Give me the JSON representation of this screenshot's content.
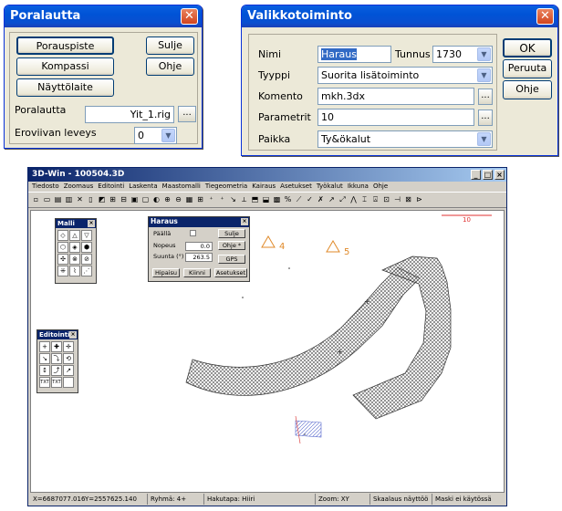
{
  "poralautta": {
    "title": "Poralautta",
    "buttons": {
      "porauspiste": "Porauspiste",
      "kompassi": "Kompassi",
      "naytto": "Näyttölaite",
      "sulje": "Sulje",
      "ohje": "Ohje"
    },
    "rig_label": "Poralautta",
    "rig_value": "Yit_1.rig",
    "browse": "...",
    "width_label": "Eroviivan leveys",
    "width_value": "0"
  },
  "valikko": {
    "title": "Valikkotoiminto",
    "nimi_label": "Nimi",
    "nimi_value": "Haraus",
    "tunnus_label": "Tunnus",
    "tunnus_value": "1730",
    "tyyppi_label": "Tyyppi",
    "tyyppi_value": "Suorita lisätoiminto",
    "komento_label": "Komento",
    "komento_value": "mkh.3dx",
    "parametrit_label": "Parametrit",
    "parametrit_value": "10",
    "paikka_label": "Paikka",
    "paikka_value": "Ty&ökalut",
    "browse": "...",
    "buttons": {
      "ok": "OK",
      "peruuta": "Peruuta",
      "ohje": "Ohje"
    }
  },
  "main": {
    "title": "3D-Win - 100504.3D",
    "controls": {
      "minimize": "_",
      "maximize": "□",
      "close": "×"
    },
    "menu": [
      "Tiedosto",
      "Zoomaus",
      "Editointi",
      "Laskenta",
      "Maastomalli",
      "Tiegeometria",
      "Kairaus",
      "Asetukset",
      "Työkalut",
      "Ikkuna",
      "Ohje"
    ],
    "scale_label": "10",
    "markers": [
      {
        "label": "4"
      },
      {
        "label": "5"
      }
    ],
    "status": {
      "x": "X=6687077.016",
      "y": "Y=2557625.140",
      "ryhma": "Ryhmä: 4+",
      "haku": "Hakutapa: Hiiri",
      "zoom": "Zoom: XY",
      "skaalaus": "Skaalaus näyttöö",
      "maski": "Maski ei käytössä"
    }
  },
  "malli_palette": {
    "title": "Malli",
    "close": "×"
  },
  "editointi_palette": {
    "title": "Editointi",
    "close": "×",
    "txt1": "TXT",
    "txt2": "TXT"
  },
  "haraus": {
    "title": "Haraus",
    "close": "×",
    "paalla_label": "Päällä",
    "nopeus_label": "Nopeus",
    "nopeus_value": "0.0",
    "suunta_label": "Suunta (°)",
    "suunta_value": "263.5",
    "buttons": {
      "sulje": "Sulje",
      "ohje": "Ohje *",
      "gps": "GPS",
      "hipaisu": "Hipaisu",
      "kiinni": "Kiinni",
      "asetukset": "Asetukset"
    }
  },
  "colors": {
    "xp_blue": "#0053d6",
    "classic_blue": "#0a246a",
    "marker": "#e08a2a",
    "hatch": "#555555"
  }
}
